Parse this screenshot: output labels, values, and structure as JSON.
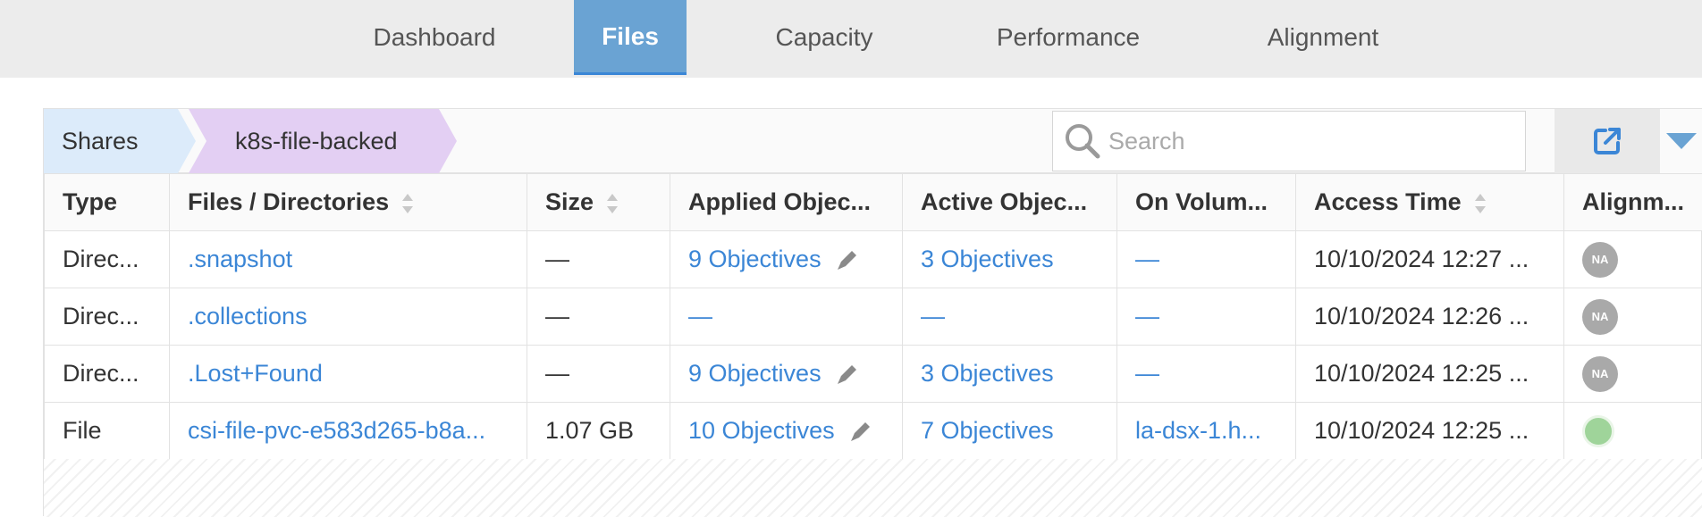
{
  "nav": {
    "tabs": [
      {
        "label": "Dashboard",
        "active": false
      },
      {
        "label": "Files",
        "active": true
      },
      {
        "label": "Capacity",
        "active": false
      },
      {
        "label": "Performance",
        "active": false
      },
      {
        "label": "Alignment",
        "active": false
      }
    ]
  },
  "breadcrumb": [
    "Shares",
    "k8s-file-backed"
  ],
  "search": {
    "placeholder": "Search",
    "value": ""
  },
  "icons": {
    "export": "external-link-icon",
    "dropdown": "caret-down-icon",
    "search": "search-icon",
    "edit": "pencil-icon"
  },
  "colors": {
    "accent": "#6aa3d3",
    "link": "#3b86d6",
    "crumb1": "#dcebfa",
    "crumb2": "#e3cff3",
    "ok": "#9fd49a",
    "na": "#a9a9a9"
  },
  "table": {
    "columns": [
      "Type",
      "Files / Directories",
      "Size",
      "Applied Objec...",
      "Active Objec...",
      "On Volum...",
      "Access Time",
      "Alignm..."
    ],
    "rows": [
      {
        "type": "Direc...",
        "name": ".snapshot",
        "size": "—",
        "applied": "9 Objectives",
        "active": "3 Objectives",
        "volume": "—",
        "access": "10/10/2024 12:27 ...",
        "alignment": "NA"
      },
      {
        "type": "Direc...",
        "name": ".collections",
        "size": "—",
        "applied": "—",
        "active": "—",
        "volume": "—",
        "access": "10/10/2024 12:26 ...",
        "alignment": "NA"
      },
      {
        "type": "Direc...",
        "name": ".Lost+Found",
        "size": "—",
        "applied": "9 Objectives",
        "active": "3 Objectives",
        "volume": "—",
        "access": "10/10/2024 12:25 ...",
        "alignment": "NA"
      },
      {
        "type": "File",
        "name": "csi-file-pvc-e583d265-b8a...",
        "size": "1.07 GB",
        "applied": "10 Objectives",
        "active": "7 Objectives",
        "volume": "la-dsx-1.h...",
        "access": "10/10/2024 12:25 ...",
        "alignment": "ok"
      }
    ]
  }
}
